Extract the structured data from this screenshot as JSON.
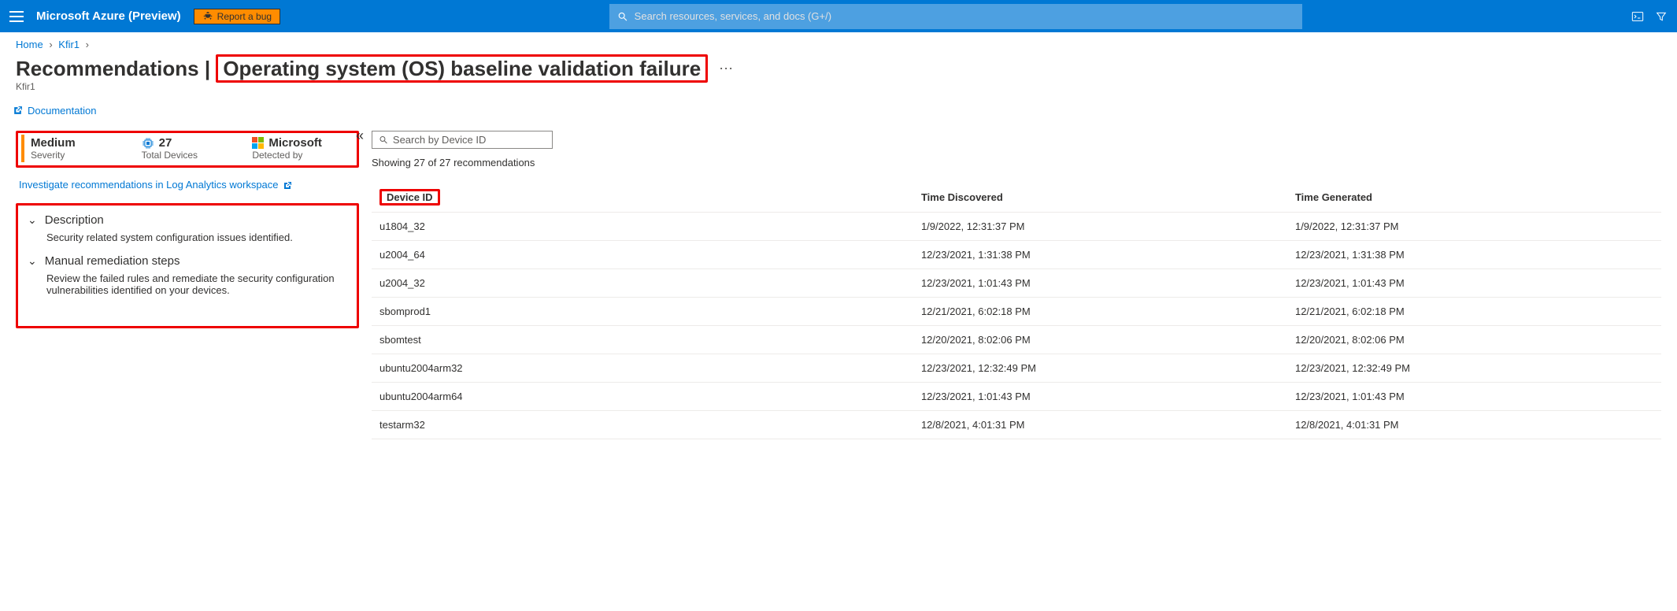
{
  "header": {
    "brand": "Microsoft Azure (Preview)",
    "bug_button": "Report a bug",
    "search_placeholder": "Search resources, services, and docs (G+/)"
  },
  "breadcrumb": {
    "home": "Home",
    "item2": "Kfir1"
  },
  "page": {
    "title_prefix": "Recommendations | ",
    "title_highlight": "Operating system (OS) baseline validation failure",
    "subtitle": "Kfir1",
    "doc_link": "Documentation"
  },
  "left": {
    "severity_value": "Medium",
    "severity_label": "Severity",
    "devices_value": "27",
    "devices_label": "Total Devices",
    "detected_value": "Microsoft",
    "detected_label": "Detected by",
    "investigate_link": "Investigate recommendations in Log Analytics workspace",
    "description_head": "Description",
    "description_body": "Security related system configuration issues identified.",
    "remediation_head": "Manual remediation steps",
    "remediation_body": "Review the failed rules and remediate the security configuration vulnerabilities identified on your devices."
  },
  "right": {
    "search_placeholder": "Search by Device ID",
    "showing": "Showing 27 of 27 recommendations",
    "columns": {
      "device": "Device ID",
      "discovered": "Time Discovered",
      "generated": "Time Generated"
    },
    "rows": [
      {
        "device": "u1804_32",
        "discovered": "1/9/2022, 12:31:37 PM",
        "generated": "1/9/2022, 12:31:37 PM"
      },
      {
        "device": "u2004_64",
        "discovered": "12/23/2021, 1:31:38 PM",
        "generated": "12/23/2021, 1:31:38 PM"
      },
      {
        "device": "u2004_32",
        "discovered": "12/23/2021, 1:01:43 PM",
        "generated": "12/23/2021, 1:01:43 PM"
      },
      {
        "device": "sbomprod1",
        "discovered": "12/21/2021, 6:02:18 PM",
        "generated": "12/21/2021, 6:02:18 PM"
      },
      {
        "device": "sbomtest",
        "discovered": "12/20/2021, 8:02:06 PM",
        "generated": "12/20/2021, 8:02:06 PM"
      },
      {
        "device": "ubuntu2004arm32",
        "discovered": "12/23/2021, 12:32:49 PM",
        "generated": "12/23/2021, 12:32:49 PM"
      },
      {
        "device": "ubuntu2004arm64",
        "discovered": "12/23/2021, 1:01:43 PM",
        "generated": "12/23/2021, 1:01:43 PM"
      },
      {
        "device": "testarm32",
        "discovered": "12/8/2021, 4:01:31 PM",
        "generated": "12/8/2021, 4:01:31 PM"
      }
    ]
  }
}
